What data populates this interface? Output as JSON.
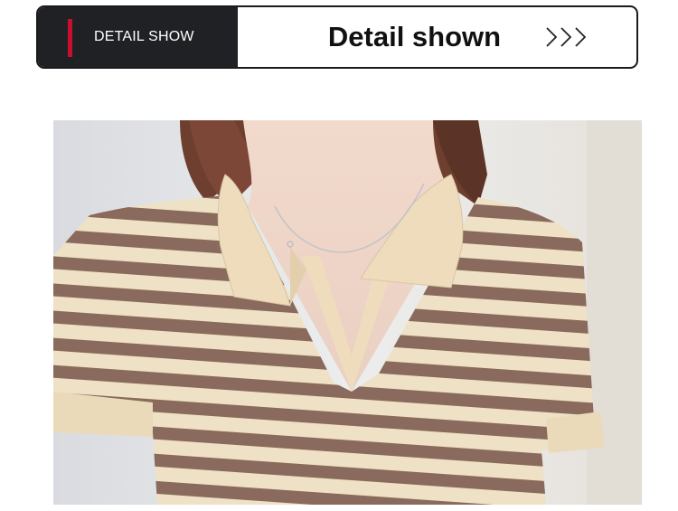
{
  "banner": {
    "left_label": "DETAIL SHOW",
    "title": "Detail shown",
    "arrow_icon": "triple-chevron-right-icon",
    "colors": {
      "dark_panel": "#202124",
      "accent": "#c8102e",
      "border": "#1a1a1a"
    }
  },
  "photo": {
    "subject": "striped-polo-knit-top-photo",
    "colors": {
      "stripe_brown": "#8a6a5c",
      "stripe_cream": "#eee1c6",
      "collar": "#eedcbc"
    }
  }
}
